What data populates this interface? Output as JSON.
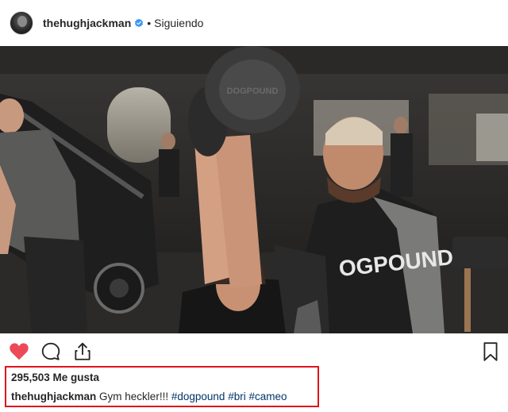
{
  "header": {
    "username": "thehughjackman",
    "dot": "•",
    "follow_status": "Siguiendo"
  },
  "post": {
    "likes": "295,503 Me gusta",
    "caption_user": "thehughjackman",
    "caption_text": "Gym heckler!!!",
    "hashtags": [
      "#dogpound",
      "#bri",
      "#cameo"
    ],
    "plate_text": "DOGPOUND",
    "shirt_text": "OGPOUND"
  },
  "colors": {
    "like_red": "#ed4956",
    "verified_blue": "#3897f0",
    "hashtag_blue": "#003569",
    "highlight_red": "#e0141e"
  }
}
